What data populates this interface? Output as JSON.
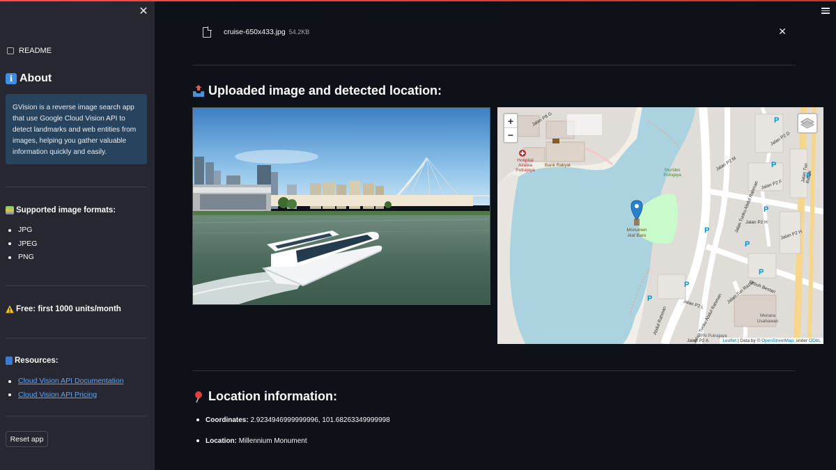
{
  "sidebar": {
    "readme_label": "README",
    "about": {
      "title": "About",
      "text": "GVision is a reverse image search app that use Google Cloud Vision API to detect landmarks and web entities from images, helping you gather valuable information quickly and easily."
    },
    "formats": {
      "title": "Supported image formats:",
      "items": [
        "JPG",
        "JPEG",
        "PNG"
      ]
    },
    "free_text": "Free: first 1000 units/month",
    "resources": {
      "title": "Resources:",
      "links": [
        "Cloud Vision API Documentation",
        "Cloud Vision API Pricing"
      ]
    },
    "reset_label": "Reset app"
  },
  "uploader": {
    "file_name": "cruise-650x433.jpg",
    "file_size": "54.2KB"
  },
  "sections": {
    "uploaded_title": "Uploaded image and detected location:",
    "location_title": "Location information:"
  },
  "map": {
    "labels": {
      "hospital": "Hospital Azalea Putrajaya",
      "bank": "Bank Rakyat",
      "skyrides": "Skyrides Putrajaya",
      "monument": "Monumen Alaf Baru",
      "menara": "Menara Usahawan",
      "jalan_p8g": "Jalan P8 G",
      "jalan_p2m": "Jalan P2 M",
      "jalan_p2d": "Jalan P2 D",
      "jalan_p2f": "Jalan P2 F",
      "jalan_p2h": "Jalan P2 H",
      "jalan_p2h2": "Jalan P2 H",
      "jalan_p2l": "Jalan P2 L",
      "jalan_p2a": "Jalan P2 A",
      "tunku": "Jalan Tunku Abdul Rahman",
      "tunku2": "Jalan Tunku Abdul Rahman",
      "tunrazak": "Jalan Tun Razak",
      "tunrazak2": "Jalan Tun Razak",
      "lebuh": "Lebuh Bestari",
      "jpn": "JPN Putrajaya",
      "abdul": "Abdul Rahman"
    },
    "zoom_in": "+",
    "zoom_out": "−",
    "attribution_leaflet": "Leaflet",
    "attribution_sep": " | Data by © ",
    "attribution_osm": "OpenStreetMap",
    "attribution_under": ", under ",
    "attribution_odbl": "ODbL"
  },
  "location_info": {
    "coordinates_label": "Coordinates:",
    "coordinates_value": "2.9234946999999996, 101.68263349999998",
    "location_label": "Location:",
    "location_value": "Millennium Monument"
  },
  "icons": {
    "close": "✕",
    "remove": "✕"
  },
  "colors": {
    "app_bg": "#0e1117",
    "sidebar_bg": "#262730",
    "about_box": "#28435e",
    "link": "#5aa7ff",
    "map_water": "#aad3df",
    "map_park": "#c8facc"
  }
}
